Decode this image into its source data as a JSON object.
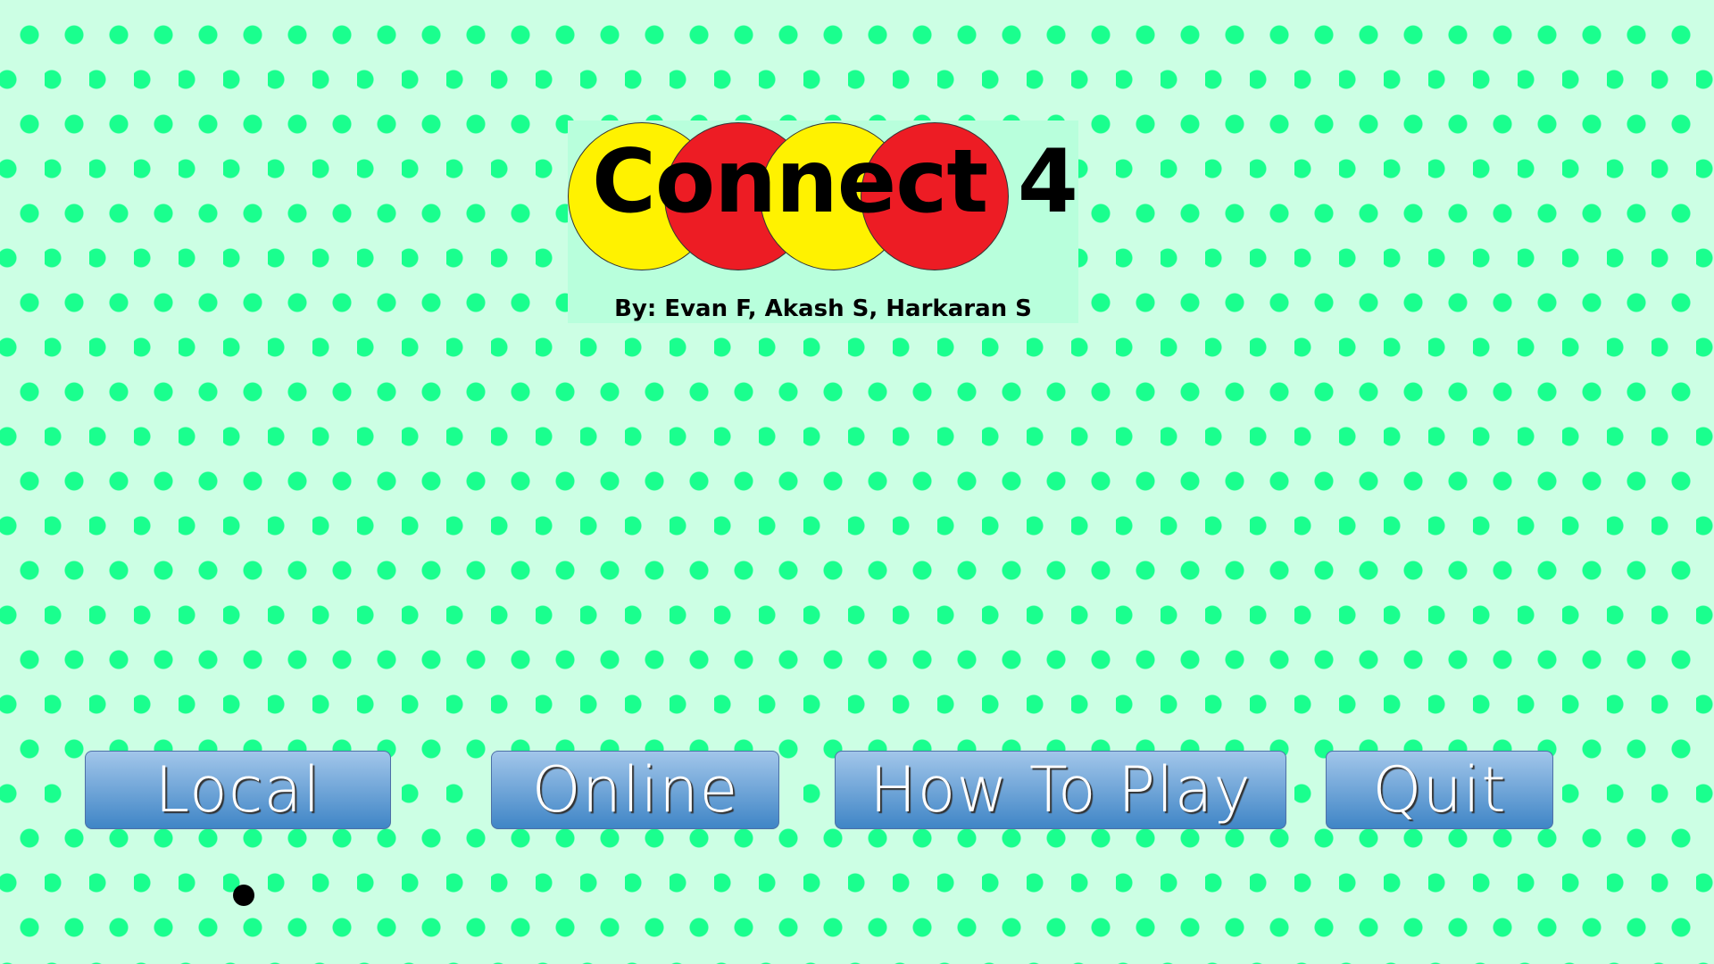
{
  "logo": {
    "title": "Connect",
    "number": "4",
    "credits": "By: Evan F, Akash S, Harkaran S",
    "disc_colors": [
      "#fff200",
      "#ed1c24",
      "#fff200",
      "#ed1c24"
    ]
  },
  "menu": {
    "local": "Local",
    "online": "Online",
    "how_to_play": "How To Play",
    "quit": "Quit"
  },
  "colors": {
    "background": "#ccffe4",
    "dots": "#1aff8e",
    "button_top": "#a2c6ea",
    "button_bottom": "#3f85c6"
  }
}
